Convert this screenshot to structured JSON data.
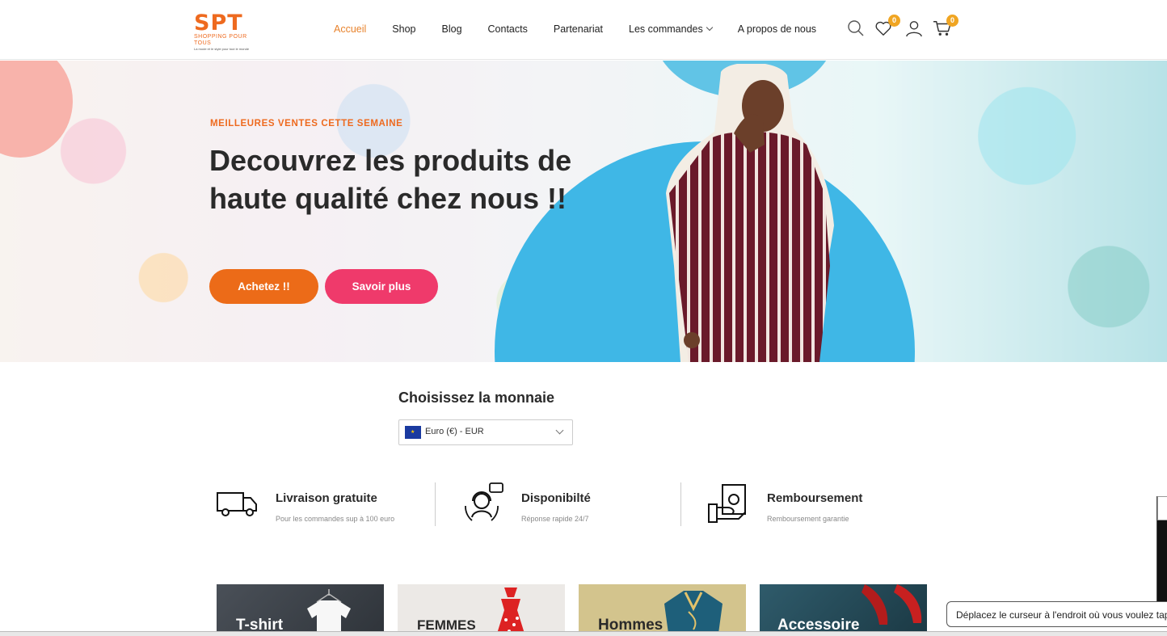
{
  "brand": {
    "logo_main": "SPT",
    "logo_sub": "SHOPPING POUR TOUS",
    "logo_tag": "La mode et le style pour tout le monde",
    "accent": "#ee6a1f"
  },
  "nav": {
    "items": [
      {
        "label": "Accueil",
        "active": true
      },
      {
        "label": "Shop"
      },
      {
        "label": "Blog"
      },
      {
        "label": "Contacts"
      },
      {
        "label": "Partenariat"
      },
      {
        "label": "Les commandes",
        "dropdown": true
      },
      {
        "label": "A propos de nous"
      }
    ],
    "icons": {
      "search": "search-icon",
      "wishlist": "heart-icon",
      "account": "user-icon",
      "cart": "cart-icon"
    },
    "wishlist_count": "0",
    "cart_count": "0"
  },
  "hero": {
    "kicker": "MEILLEURES VENTES CETTE SEMAINE",
    "title": "Decouvrez les produits de haute qualité chez nous !!",
    "buy_label": "Achetez !!",
    "more_label": "Savoir plus",
    "buy_color": "#ec6b18",
    "more_color": "#ef3a6b"
  },
  "currency": {
    "title": "Choisissez la monnaie",
    "selected": "Euro (€) - EUR",
    "flag": "eu-flag-icon"
  },
  "features": [
    {
      "title": "Livraison gratuite",
      "subtitle": "Pour les commandes sup à 100 euro",
      "icon": "truck-icon"
    },
    {
      "title": "Disponibilté",
      "subtitle": "Réponse rapide 24/7",
      "icon": "support-agent-icon"
    },
    {
      "title": "Remboursement",
      "subtitle": "Remboursement garantie",
      "icon": "money-hand-icon"
    }
  ],
  "categories": [
    {
      "label": "T-shirt"
    },
    {
      "label": "FEMMES"
    },
    {
      "label": "Hommes"
    },
    {
      "label": "Accessoire"
    }
  ],
  "tooltip": {
    "text": "Déplacez le curseur à l'endroit où vous voulez taper"
  }
}
